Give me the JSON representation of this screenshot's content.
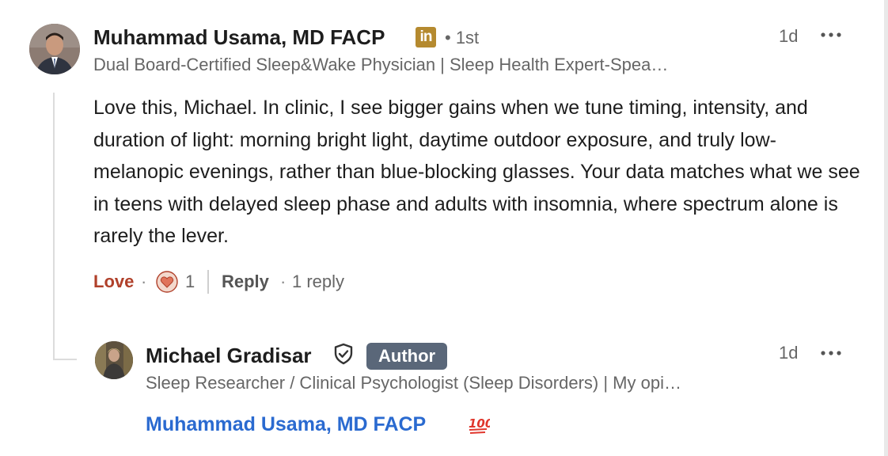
{
  "comment": {
    "author_name": "Muhammad Usama, MD FACP",
    "linkedin_badge": "in",
    "connection_degree": "• 1st",
    "headline": "Dual Board-Certified Sleep&Wake Physician | Sleep Health Expert-Spea…",
    "time": "1d",
    "body": "Love this, Michael. In clinic, I see bigger gains when we tune timing, intensity, and duration of light: morning bright light, daytime outdoor exposure, and truly low-melanopic evenings, rather than blue-blocking glasses. Your data matches what we see in teens with delayed sleep phase and adults with insomnia, where spectrum alone is rarely the lever.",
    "actions": {
      "love_label": "Love",
      "dot1": "·",
      "reaction_count": "1",
      "reply_label": "Reply",
      "dot2": "·",
      "replies_count": "1 reply"
    }
  },
  "reply": {
    "author_name": "Michael Gradisar",
    "author_badge": "Author",
    "headline": "Sleep Researcher / Clinical Psychologist (Sleep Disorders) | My opi…",
    "time": "1d",
    "mention": "Muhammad Usama, MD FACP"
  },
  "colors": {
    "love": "#b0402a",
    "mention": "#2a6ad0",
    "author_badge": "#5a6779",
    "linkedin_badge": "#b58a2f"
  },
  "icons": [
    "linkedin-icon",
    "more-options-icon",
    "love-reaction-icon",
    "verified-shield-icon",
    "hundred-points-emoji-icon"
  ]
}
